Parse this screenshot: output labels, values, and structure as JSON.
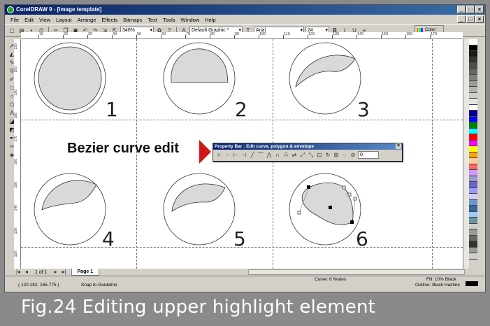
{
  "window": {
    "title": "CorelDRAW 9 - [image template]",
    "min_label": "_",
    "max_label": "□",
    "close_label": "×"
  },
  "menu": [
    "File",
    "Edit",
    "View",
    "Layout",
    "Arrange",
    "Effects",
    "Bitmaps",
    "Text",
    "Tools",
    "Window",
    "Help"
  ],
  "toolbar": {
    "zoom_value": "340%",
    "graphic_style": "Default Graphic *",
    "font_name": "Arial",
    "font_size": "24",
    "color_label": "Color"
  },
  "ruler": {
    "h_ticks": [
      "10",
      "20",
      "30",
      "40",
      "50",
      "60",
      "70",
      "80",
      "90",
      "100",
      "110",
      "120",
      "130",
      "140",
      "150",
      "160",
      "170"
    ],
    "v_ticks": [
      "220",
      "200",
      "190",
      "180",
      "170",
      "160",
      "150",
      "140",
      "130",
      "120"
    ]
  },
  "canvas": {
    "labels": [
      "1",
      "2",
      "3",
      "4",
      "5",
      "6"
    ],
    "annotation": "Bezier curve edit"
  },
  "property_bar": {
    "title": "Property Bar : Edit curve, polygon & envelope",
    "spin_value": "0"
  },
  "pages": {
    "counter": "1 of 1",
    "tab": "Page 1"
  },
  "status": {
    "coords": "( 120.182, 165.775 )",
    "snap": "Snap to Guideline",
    "object": "Curve: 6 Nodes",
    "fill": "Fill: 10% Black",
    "outline": "Outline: Black  Hairline"
  },
  "caption": "Fig.24  Editing upper highlight element",
  "colors": {
    "shape_fill": "#d9d9d9",
    "palette": [
      "#ffffff",
      "#000000",
      "#1a1a1a",
      "#333333",
      "#4d4d4d",
      "#666666",
      "#808080",
      "#999999",
      "#b3b3b3",
      "#cccccc",
      "#e6e6e6",
      "#ffffff",
      "#00008b",
      "#0000ff",
      "#008000",
      "#00ffff",
      "#ff0000",
      "#ff00ff",
      "#ffff00",
      "#ffa500",
      "#ffcc99",
      "#ff6666",
      "#cc99ff",
      "#9999cc",
      "#6666cc",
      "#9999ff",
      "#ccccff",
      "#6699cc",
      "#336699",
      "#99ccff",
      "#669999",
      "#cccccc",
      "#999999",
      "#666666",
      "#333333",
      "#999999",
      "#cccccc"
    ]
  }
}
